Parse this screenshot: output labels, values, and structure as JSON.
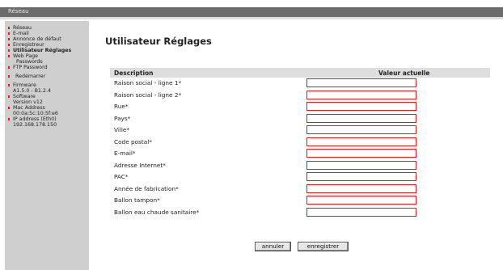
{
  "window": {
    "title": "Réseau"
  },
  "sidebar": {
    "items": [
      {
        "label": "Réseau",
        "active": false
      },
      {
        "label": "E-mail",
        "active": false
      },
      {
        "label": "Annonce de défaut",
        "active": false
      },
      {
        "label": "Enregistreur",
        "active": false
      },
      {
        "label": "Utilisateur Réglages",
        "active": true
      },
      {
        "label": "Web Page",
        "label2": "Passwords",
        "active": false
      },
      {
        "label": "FTP Password",
        "active": false
      },
      {
        "label": "Redémarrer",
        "active": false
      },
      {
        "label": "Firmware",
        "label2": "A1.5.0 - B1.2.4",
        "active": false
      },
      {
        "label": "Software",
        "label2": "Version v12",
        "active": false
      },
      {
        "label": "Mac Address",
        "label2": "00:0a:5c:10:5f:e6",
        "active": false
      },
      {
        "label": "IP address (Eth0)",
        "label2": "192.168.178.150",
        "active": false
      }
    ]
  },
  "main": {
    "title": "Utilisateur Réglages",
    "table": {
      "col_description": "Description",
      "col_value": "Valeur actuelle",
      "rows": [
        {
          "label": "Raison social - ligne 1*",
          "value": ""
        },
        {
          "label": "Raison social - ligne 2*",
          "value": ""
        },
        {
          "label": "Rue*",
          "value": ""
        },
        {
          "label": "Pays*",
          "value": ""
        },
        {
          "label": "Ville*",
          "value": ""
        },
        {
          "label": "Code postal*",
          "value": ""
        },
        {
          "label": "E-mail*",
          "value": ""
        },
        {
          "label": "Adresse Internet*",
          "value": ""
        },
        {
          "label": "PAC*",
          "value": ""
        },
        {
          "label": "Année de fabrication*",
          "value": ""
        },
        {
          "label": "Ballon tampon*",
          "value": ""
        },
        {
          "label": "Ballon eau chaude sanitaire*",
          "value": ""
        }
      ]
    },
    "buttons": {
      "cancel": "annuler",
      "save": "enregistrer"
    }
  },
  "colors": {
    "accent": "#cc2222",
    "header_bg": "#6b6b6b",
    "sidebar_bg": "#cfcfcf",
    "table_header_bg": "#dedede",
    "input_border": "#d42020"
  }
}
